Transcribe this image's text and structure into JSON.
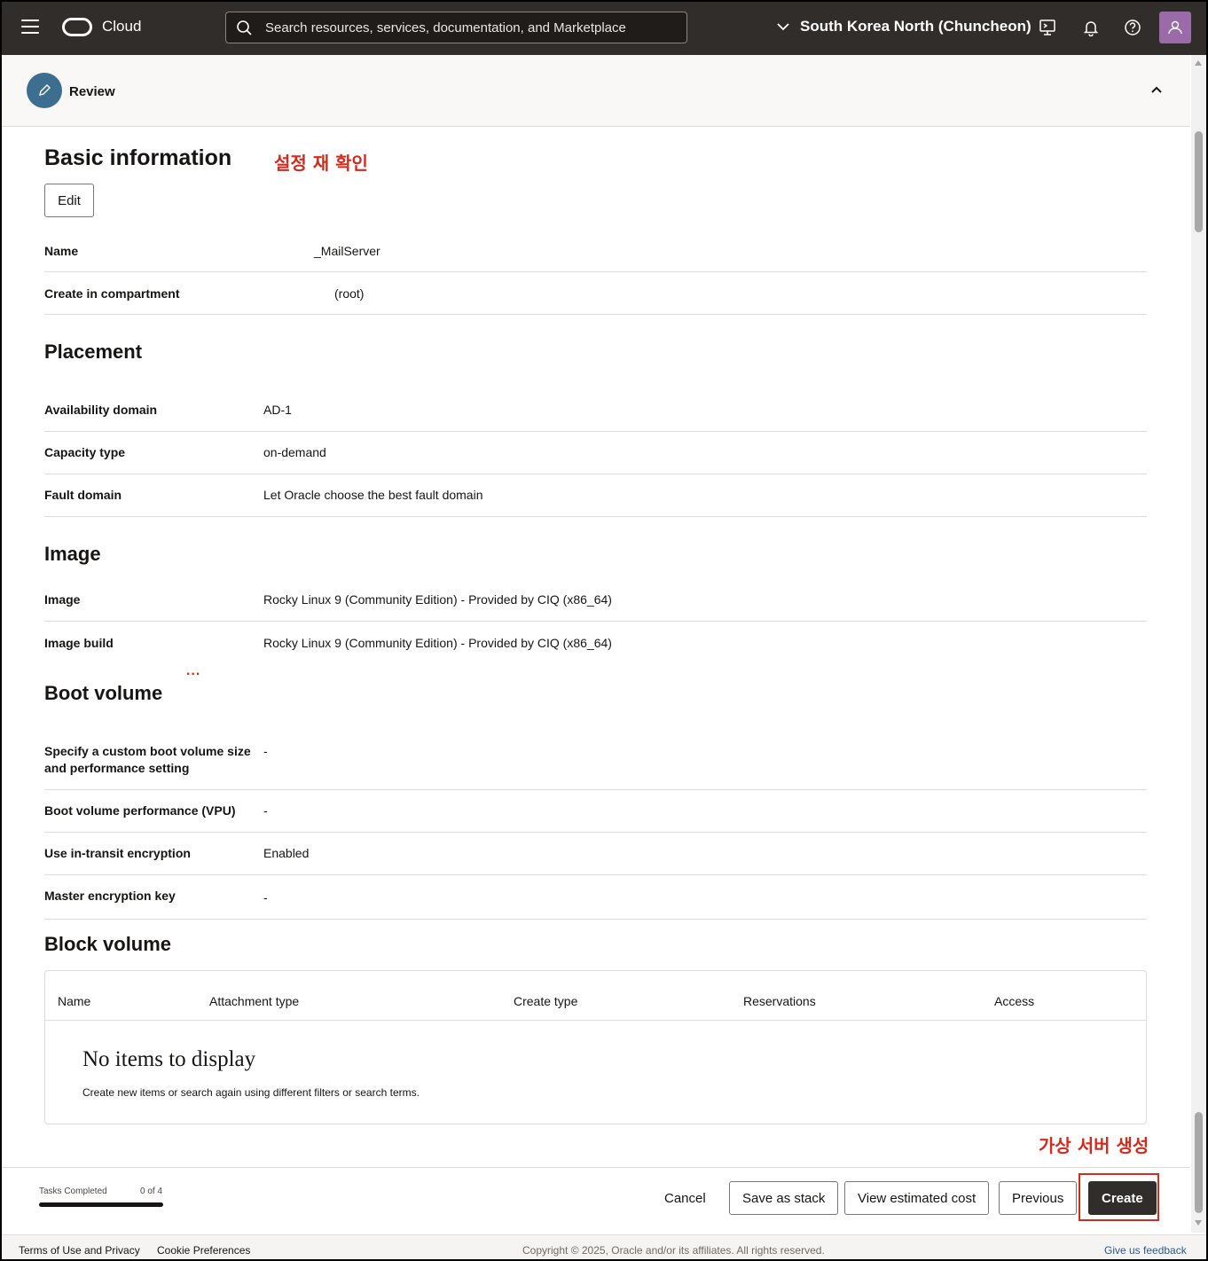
{
  "topbar": {
    "brand": "Cloud",
    "search_placeholder": "Search resources, services, documentation, and Marketplace",
    "region": "South Korea North (Chuncheon)"
  },
  "review": {
    "label": "Review"
  },
  "annotations": {
    "review_note": "설정 재 확인",
    "create_note": "가상 서버 생성",
    "ellipsis": "..."
  },
  "basic": {
    "title": "Basic information",
    "edit_label": "Edit",
    "rows": [
      {
        "key": "Name",
        "value": "_MailServer"
      },
      {
        "key": "Create in compartment",
        "value": "(root)"
      }
    ]
  },
  "placement": {
    "title": "Placement",
    "rows": [
      {
        "key": "Availability domain",
        "value": "AD-1"
      },
      {
        "key": "Capacity type",
        "value": "on-demand"
      },
      {
        "key": "Fault domain",
        "value": "Let Oracle choose the best fault domain"
      }
    ]
  },
  "image": {
    "title": "Image",
    "rows": [
      {
        "key": "Image",
        "value": "Rocky Linux 9 (Community Edition) - Provided by CIQ (x86_64)"
      },
      {
        "key": "Image build",
        "value": "Rocky Linux 9 (Community Edition) - Provided by CIQ (x86_64)"
      }
    ]
  },
  "boot": {
    "title": "Boot volume",
    "rows": [
      {
        "key": "Specify a custom boot volume size and performance setting",
        "value": "-"
      },
      {
        "key": "Boot volume performance (VPU)",
        "value": "-"
      },
      {
        "key": "Use in-transit encryption",
        "value": "Enabled"
      },
      {
        "key": "Master encryption key",
        "value": "-"
      }
    ]
  },
  "block": {
    "title": "Block volume",
    "columns": [
      "Name",
      "Attachment type",
      "Create type",
      "Reservations",
      "Access"
    ],
    "empty_title": "No items to display",
    "empty_sub": "Create new items or search again using different filters or search terms."
  },
  "footer": {
    "tasks_label": "Tasks Completed",
    "tasks_count": "0 of 4",
    "tasks_completed": 0,
    "tasks_total": 4,
    "cancel": "Cancel",
    "save_stack": "Save as stack",
    "estimated_cost": "View estimated cost",
    "previous": "Previous",
    "create": "Create"
  },
  "bottom": {
    "terms": "Terms of Use and Privacy",
    "cookies": "Cookie Preferences",
    "copyright": "Copyright © 2025, Oracle and/or its affiliates. All rights reserved.",
    "feedback": "Give us feedback"
  },
  "colors": {
    "topbar": "#312d2a",
    "annotation": "#d52b1e",
    "primary_button": "#312d2a"
  }
}
